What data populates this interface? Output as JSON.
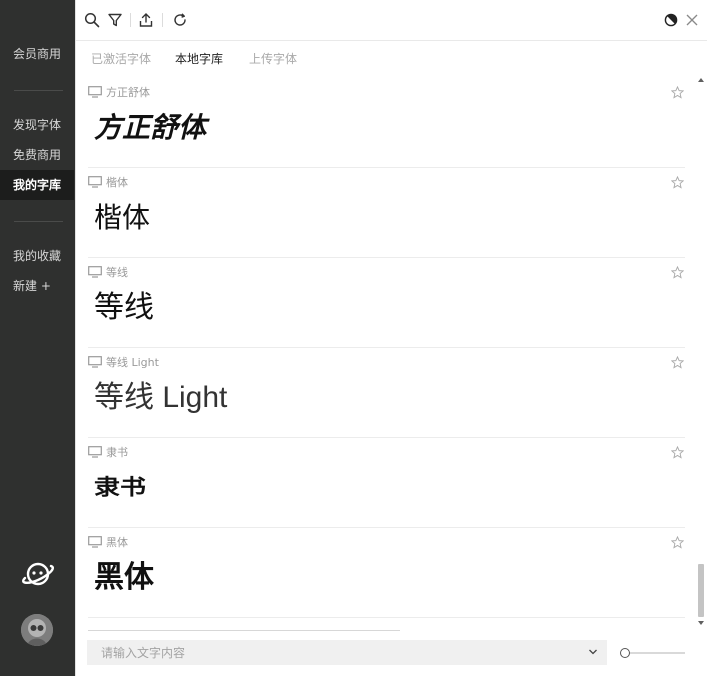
{
  "sidebar": {
    "top_item": "会员商用",
    "group1": [
      "发现字体",
      "免费商用",
      "我的字库"
    ],
    "active_item": "我的字库",
    "group2": [
      "我的收藏",
      "新建 +"
    ]
  },
  "toolbar": {
    "icons": [
      "search-icon",
      "filter-icon",
      "export-icon",
      "refresh-icon",
      "theme-toggle-icon",
      "close-icon"
    ]
  },
  "tabs": [
    {
      "label": "已激活字体",
      "active": false
    },
    {
      "label": "本地字库",
      "active": true
    },
    {
      "label": "上传字体",
      "active": false
    }
  ],
  "fonts": [
    {
      "name": "方正舒体",
      "preview": "方正舒体",
      "style": "shu"
    },
    {
      "name": "楷体",
      "preview": "楷体",
      "style": "kai"
    },
    {
      "name": "等线",
      "preview": "等线",
      "style": "plain"
    },
    {
      "name": "等线 Light",
      "preview": "等线 Light",
      "style": "light"
    },
    {
      "name": "隶书",
      "preview": "隶书",
      "style": "li"
    },
    {
      "name": "黑体",
      "preview": "黑体",
      "style": "hei"
    }
  ],
  "bottom": {
    "input_placeholder": "请输入文字内容",
    "input_value": "",
    "size_slider_fraction": 0
  },
  "colors": {
    "sidebar_bg": "#2f302f",
    "sidebar_active_bg": "#1c1d1c"
  }
}
